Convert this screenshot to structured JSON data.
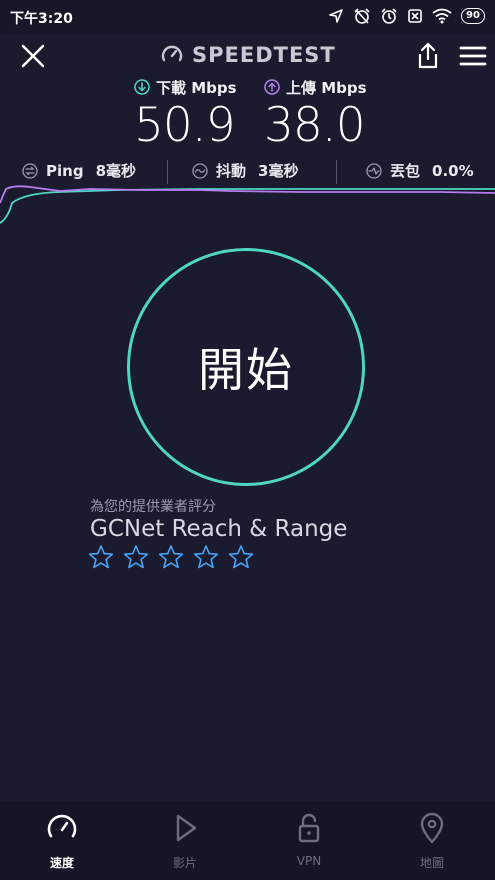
{
  "status": {
    "time": "下午3:20",
    "battery": "90"
  },
  "app": {
    "brand": "SPEEDTEST"
  },
  "download": {
    "label": "下載 Mbps",
    "value": "50.9"
  },
  "upload": {
    "label": "上傳 Mbps",
    "value": "38.0"
  },
  "metrics": {
    "ping": {
      "label": "Ping",
      "value": "8毫秒"
    },
    "jitter": {
      "label": "抖動",
      "value": "3毫秒"
    },
    "loss": {
      "label": "丟包",
      "value": "0.0%"
    }
  },
  "go_button": {
    "label": "開始"
  },
  "rating": {
    "caption": "為您的提供業者評分",
    "provider": "GCNet Reach & Range",
    "star_count": 5
  },
  "nav": {
    "items": [
      {
        "label": "速度",
        "icon": "speedometer-icon",
        "active": true
      },
      {
        "label": "影片",
        "icon": "play-icon",
        "active": false
      },
      {
        "label": "VPN",
        "icon": "lock-icon",
        "active": false
      },
      {
        "label": "地圖",
        "icon": "map-pin-icon",
        "active": false
      }
    ]
  },
  "colors": {
    "background": "#1a1b2e",
    "accent_teal": "#4fd6c3",
    "download_icon": "#4fd6c3",
    "upload_icon": "#b67cf0",
    "star_blue": "#4aa3f5"
  }
}
